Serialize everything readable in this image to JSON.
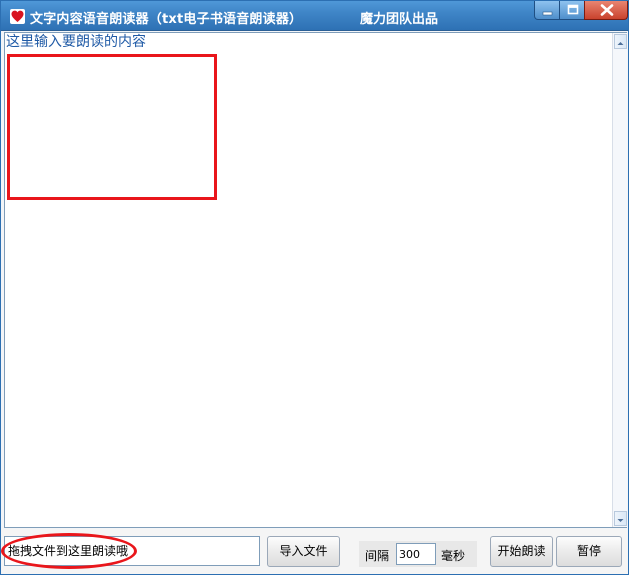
{
  "window": {
    "title": "文字内容语音朗读器（txt电子书语音朗读器）",
    "brand": "魔力团队出品",
    "icon": "heart-icon",
    "accent_color": "#e9161b",
    "title_bar_color": "#3f85c7"
  },
  "editor": {
    "text": "这里输入要朗读的内容"
  },
  "controls": {
    "drop_placeholder": "拖拽文件到这里朗读哦",
    "import_label": "导入文件",
    "interval_label": "间隔",
    "interval_value": "300",
    "unit_label": "毫秒",
    "start_label": "开始朗读",
    "pause_label": "暂停"
  }
}
